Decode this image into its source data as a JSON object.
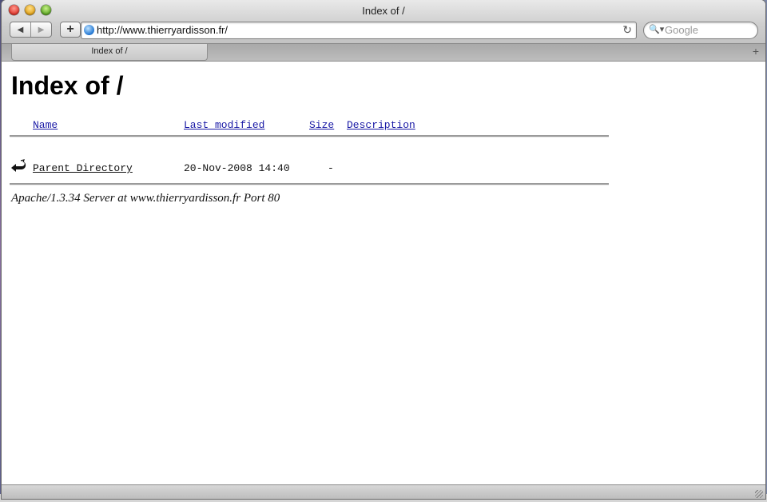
{
  "window": {
    "title": "Index of /"
  },
  "toolbar": {
    "back_glyph": "◀",
    "forward_glyph": "▶",
    "add_glyph": "+",
    "reload_glyph": "↻",
    "url": "http://www.thierryardisson.fr/",
    "search_placeholder": "Google",
    "search_glyph": "🔍▾"
  },
  "tabs": [
    {
      "label": "Index of /"
    }
  ],
  "new_tab_glyph": "+",
  "page": {
    "heading": "Index of /",
    "columns": {
      "name": "Name",
      "last_modified": "Last modified",
      "size": "Size",
      "description": "Description"
    },
    "rows": [
      {
        "name": "Parent Directory",
        "last_modified": "20-Nov-2008 14:40",
        "size": "-",
        "description": "",
        "icon": "back-arrow-icon"
      }
    ],
    "server_signature": "Apache/1.3.34 Server at www.thierryardisson.fr Port 80"
  },
  "colors": {
    "link": "#1a1aa6",
    "visited_link": "#3a2282",
    "rule": "#9b9b9b"
  }
}
